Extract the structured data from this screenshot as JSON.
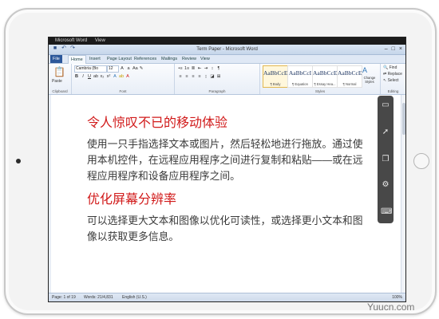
{
  "os": {
    "menu": [
      "Microsoft Word",
      "View"
    ]
  },
  "window": {
    "title": "Term Paper - Microsoft Word",
    "controls": [
      "–",
      "□",
      "×"
    ],
    "qat": [
      "save-icon",
      "undo-icon",
      "redo-icon"
    ]
  },
  "ribbon": {
    "tabs": [
      "File",
      "Home",
      "Insert",
      "Page Layout",
      "References",
      "Mailings",
      "Review",
      "View"
    ],
    "clipboard": {
      "label": "Clipboard",
      "paste": "Paste"
    },
    "font": {
      "label": "Font",
      "name": "Cambria (Bo",
      "size": "12"
    },
    "paragraph": {
      "label": "Paragraph"
    },
    "styles": {
      "label": "Styles",
      "items": [
        {
          "sample": "AaBbCcE",
          "name": "¶ Body"
        },
        {
          "sample": "AaBbCcI",
          "name": "¶ Equation"
        },
        {
          "sample": "AaBbCcE",
          "name": "¶ Essay Hea..."
        },
        {
          "sample": "AaBbCcE",
          "name": "¶ Normal"
        }
      ],
      "change": "Change Styles"
    },
    "editing": {
      "label": "Editing",
      "find": "Find",
      "replace": "Replace",
      "select": "Select"
    }
  },
  "document": {
    "heading1": "令人惊叹不已的移动体验",
    "para1": "使用一只手指选择文本或图片，然后轻松地进行拖放。通过使\n用本机控件，在远程应用程序之间进行复制和粘贴——或在远\n程应用程序和设备应用程序之间。",
    "heading2": "优化屏幕分辨率",
    "para2": "可以选择更大文本和图像以优化可读性，或选择更小文本和图\n像以获取更多信息。"
  },
  "status": {
    "page": "Page: 1 of 19",
    "words": "Words: 21/4,831",
    "language": "English (U.S.)",
    "zoom": "100%"
  },
  "watermark": "Yuucn.com"
}
